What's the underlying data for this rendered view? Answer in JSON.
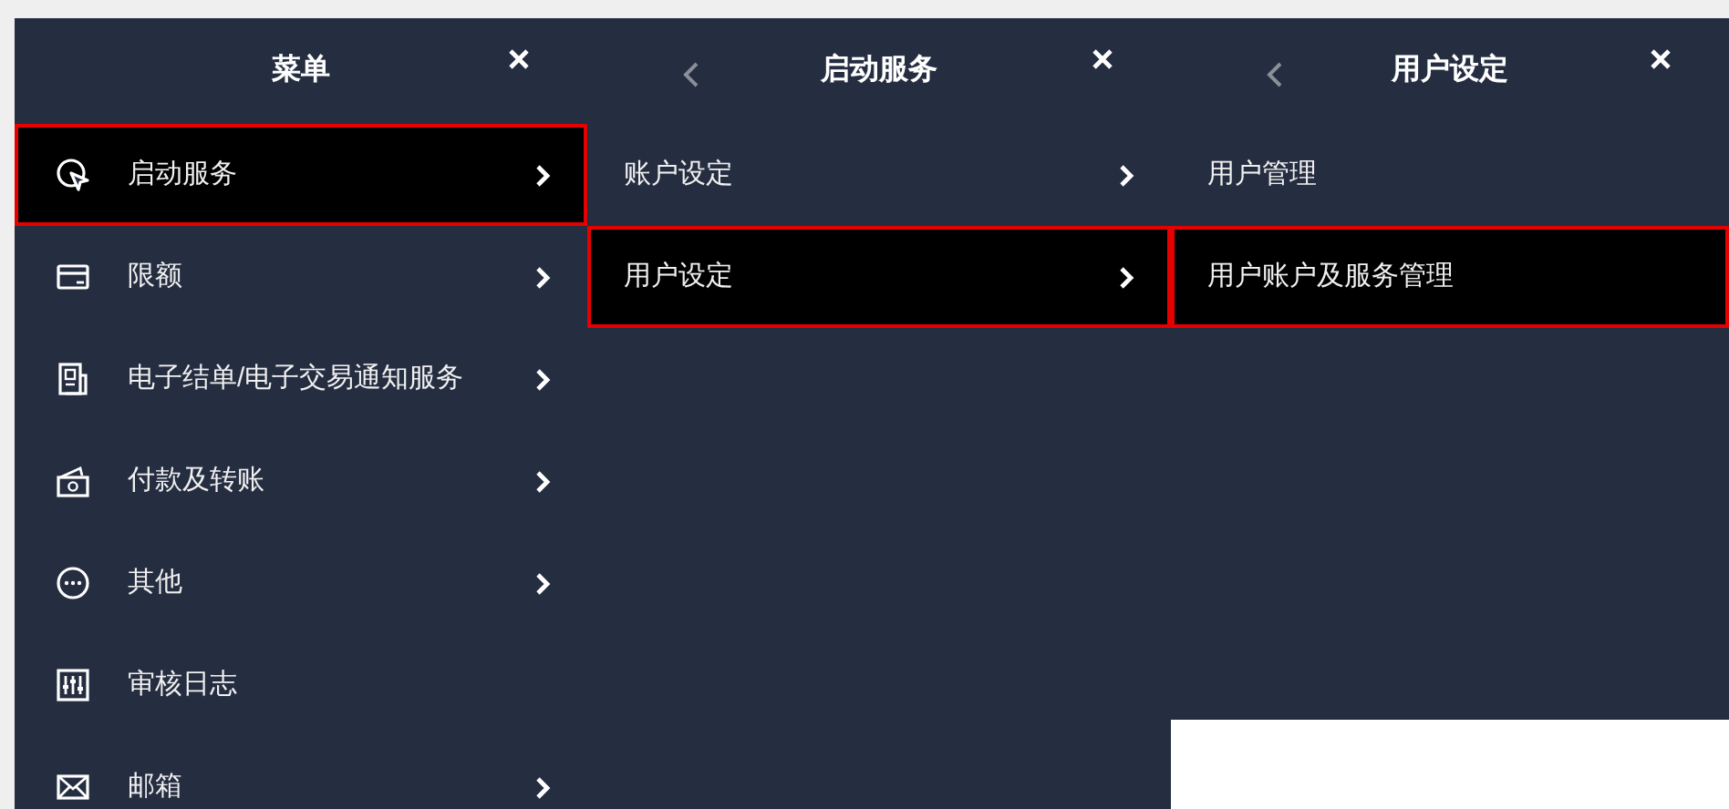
{
  "panels": [
    {
      "title": "菜单",
      "has_back": false,
      "items": [
        {
          "label": "启动服务",
          "kind": "cursor",
          "submenu": true,
          "selected": true
        },
        {
          "label": "限额",
          "kind": "card",
          "submenu": true,
          "selected": false
        },
        {
          "label": "电子结单/电子交易通知服务",
          "kind": "statement",
          "submenu": true,
          "selected": false
        },
        {
          "label": "付款及转账",
          "kind": "money",
          "submenu": true,
          "selected": false
        },
        {
          "label": "其他",
          "kind": "more",
          "submenu": true,
          "selected": false
        },
        {
          "label": "审核日志",
          "kind": "sliders",
          "submenu": false,
          "selected": false
        },
        {
          "label": "邮箱",
          "kind": "mail",
          "submenu": true,
          "selected": false
        }
      ]
    },
    {
      "title": "启动服务",
      "has_back": true,
      "items": [
        {
          "label": "账户设定",
          "submenu": true,
          "selected": false
        },
        {
          "label": "用户设定",
          "submenu": true,
          "selected": true
        }
      ]
    },
    {
      "title": "用户设定",
      "has_back": true,
      "items": [
        {
          "label": "用户管理",
          "submenu": false,
          "selected": false
        },
        {
          "label": "用户账户及服务管理",
          "submenu": false,
          "selected": true
        }
      ]
    }
  ]
}
